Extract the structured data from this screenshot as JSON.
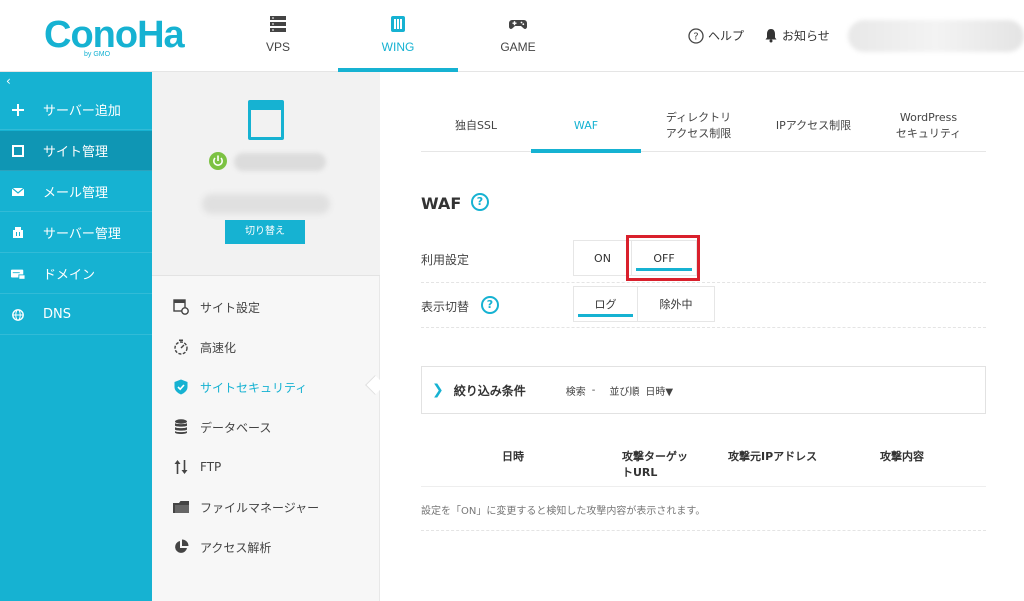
{
  "header": {
    "logo_text": "ConoHa",
    "logo_sub": "by GMO",
    "tabs": [
      {
        "label": "VPS",
        "icon": "server-icon"
      },
      {
        "label": "WING",
        "icon": "wing-icon"
      },
      {
        "label": "GAME",
        "icon": "gamepad-icon"
      }
    ],
    "help_label": "ヘルプ",
    "notice_label": "お知らせ"
  },
  "sidebar": {
    "collapse_glyph": "‹",
    "items": [
      {
        "label": "サーバー追加",
        "icon": "plus-icon"
      },
      {
        "label": "サイト管理",
        "icon": "window-icon"
      },
      {
        "label": "メール管理",
        "icon": "mail-icon"
      },
      {
        "label": "サーバー管理",
        "icon": "server-icon"
      },
      {
        "label": "ドメイン",
        "icon": "domain-icon"
      },
      {
        "label": "DNS",
        "icon": "globe-icon"
      }
    ]
  },
  "site_panel": {
    "switch_label": "切り替え",
    "menu": [
      {
        "label": "サイト設定",
        "icon": "site-settings-icon"
      },
      {
        "label": "高速化",
        "icon": "speed-icon"
      },
      {
        "label": "サイトセキュリティ",
        "icon": "shield-icon"
      },
      {
        "label": "データベース",
        "icon": "database-icon"
      },
      {
        "label": "FTP",
        "icon": "transfer-icon"
      },
      {
        "label": "ファイルマネージャー",
        "icon": "folder-icon"
      },
      {
        "label": "アクセス解析",
        "icon": "pie-chart-icon"
      }
    ]
  },
  "main": {
    "tabs": [
      {
        "label": "独自SSL"
      },
      {
        "label": "WAF"
      },
      {
        "label_line1": "ディレクトリ",
        "label_line2": "アクセス制限"
      },
      {
        "label": "IPアクセス制限"
      },
      {
        "label_line1": "WordPress",
        "label_line2": "セキュリティ"
      }
    ],
    "section_title": "WAF",
    "help_glyph": "?",
    "usage_label": "利用設定",
    "usage_on": "ON",
    "usage_off": "OFF",
    "display_label": "表示切替",
    "display_log": "ログ",
    "display_excluded": "除外中",
    "filter": {
      "chevron": "❯",
      "title": "絞り込み条件",
      "search_label": "検索",
      "search_value": "-",
      "sort_label": "並び順",
      "sort_value": "日時▼"
    },
    "table_headers": {
      "datetime": "日時",
      "target_line1": "攻撃ターゲッ",
      "target_line2": "トURL",
      "source_ip": "攻撃元IPアドレス",
      "content": "攻撃内容"
    },
    "empty_message": "設定を「ON」に変更すると検知した攻撃内容が表示されます。"
  },
  "colors": {
    "brand": "#16b2d2",
    "sidebar_active": "#0f96b4",
    "highlight_red": "#d9202c",
    "power_green": "#7cc243"
  }
}
